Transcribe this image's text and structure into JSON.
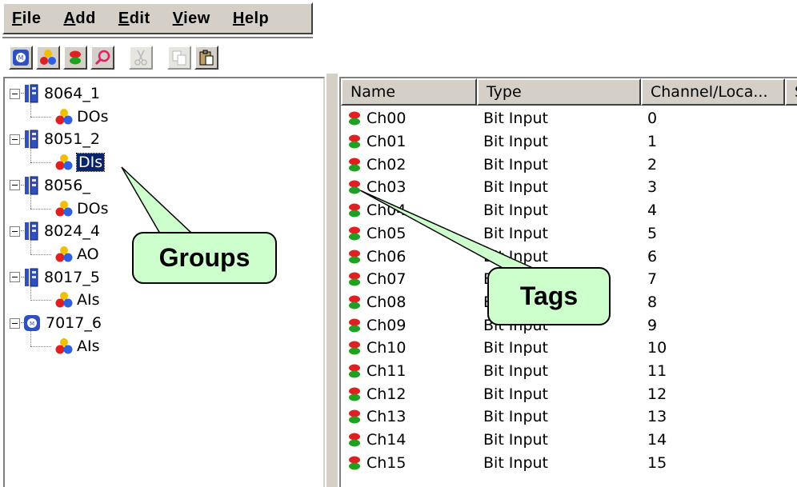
{
  "menu": {
    "items": [
      {
        "label": "File",
        "accel": "F",
        "rest": "ile"
      },
      {
        "label": "Add",
        "accel": "A",
        "rest": "dd"
      },
      {
        "label": "Edit",
        "accel": "E",
        "rest": "dit"
      },
      {
        "label": "View",
        "accel": "V",
        "rest": "iew"
      },
      {
        "label": "Help",
        "accel": "H",
        "rest": "elp"
      }
    ]
  },
  "toolbar": {
    "buttons": [
      {
        "icon": "module-icon",
        "enabled": true
      },
      {
        "icon": "group-icon",
        "enabled": true
      },
      {
        "icon": "tag-icon",
        "enabled": true
      },
      {
        "icon": "search-icon",
        "enabled": true
      },
      {
        "icon": "cut-icon",
        "enabled": false
      },
      {
        "icon": "copy-icon",
        "enabled": false
      },
      {
        "icon": "paste-icon",
        "enabled": true
      }
    ]
  },
  "tree": {
    "nodes": [
      {
        "label": "8064_1",
        "group": "DOs"
      },
      {
        "label": "8051_2",
        "group": "DIs",
        "selected": true
      },
      {
        "label": "8056_",
        "group": "DOs"
      },
      {
        "label": "8024_4",
        "group": "AO"
      },
      {
        "label": "8017_5",
        "group": "AIs"
      },
      {
        "label": "7017_6",
        "group": "AIs"
      }
    ]
  },
  "list": {
    "columns": [
      "Name",
      "Type",
      "Channel/Loca...",
      "S"
    ],
    "rows": [
      {
        "name": "Ch00",
        "type": "Bit Input",
        "channel": "0"
      },
      {
        "name": "Ch01",
        "type": "Bit Input",
        "channel": "1"
      },
      {
        "name": "Ch02",
        "type": "Bit Input",
        "channel": "2"
      },
      {
        "name": "Ch03",
        "type": "Bit Input",
        "channel": "3"
      },
      {
        "name": "Ch04",
        "type": "Bit Input",
        "channel": "4"
      },
      {
        "name": "Ch05",
        "type": "Bit Input",
        "channel": "5"
      },
      {
        "name": "Ch06",
        "type": "Bit Input",
        "channel": "6"
      },
      {
        "name": "Ch07",
        "type": "Bit Input",
        "channel": "7"
      },
      {
        "name": "Ch08",
        "type": "Bit Input",
        "channel": "8"
      },
      {
        "name": "Ch09",
        "type": "Bit Input",
        "channel": "9"
      },
      {
        "name": "Ch10",
        "type": "Bit Input",
        "channel": "10"
      },
      {
        "name": "Ch11",
        "type": "Bit Input",
        "channel": "11"
      },
      {
        "name": "Ch12",
        "type": "Bit Input",
        "channel": "12"
      },
      {
        "name": "Ch13",
        "type": "Bit Input",
        "channel": "13"
      },
      {
        "name": "Ch14",
        "type": "Bit Input",
        "channel": "14"
      },
      {
        "name": "Ch15",
        "type": "Bit Input",
        "channel": "15"
      }
    ]
  },
  "callouts": {
    "groups": "Groups",
    "tags": "Tags"
  },
  "colors": {
    "window_face": "#d4d0c8",
    "selection": "#0a246a",
    "callout_fill": "#ccffcc",
    "tag_red": "#e02020",
    "tag_green": "#20a020"
  }
}
